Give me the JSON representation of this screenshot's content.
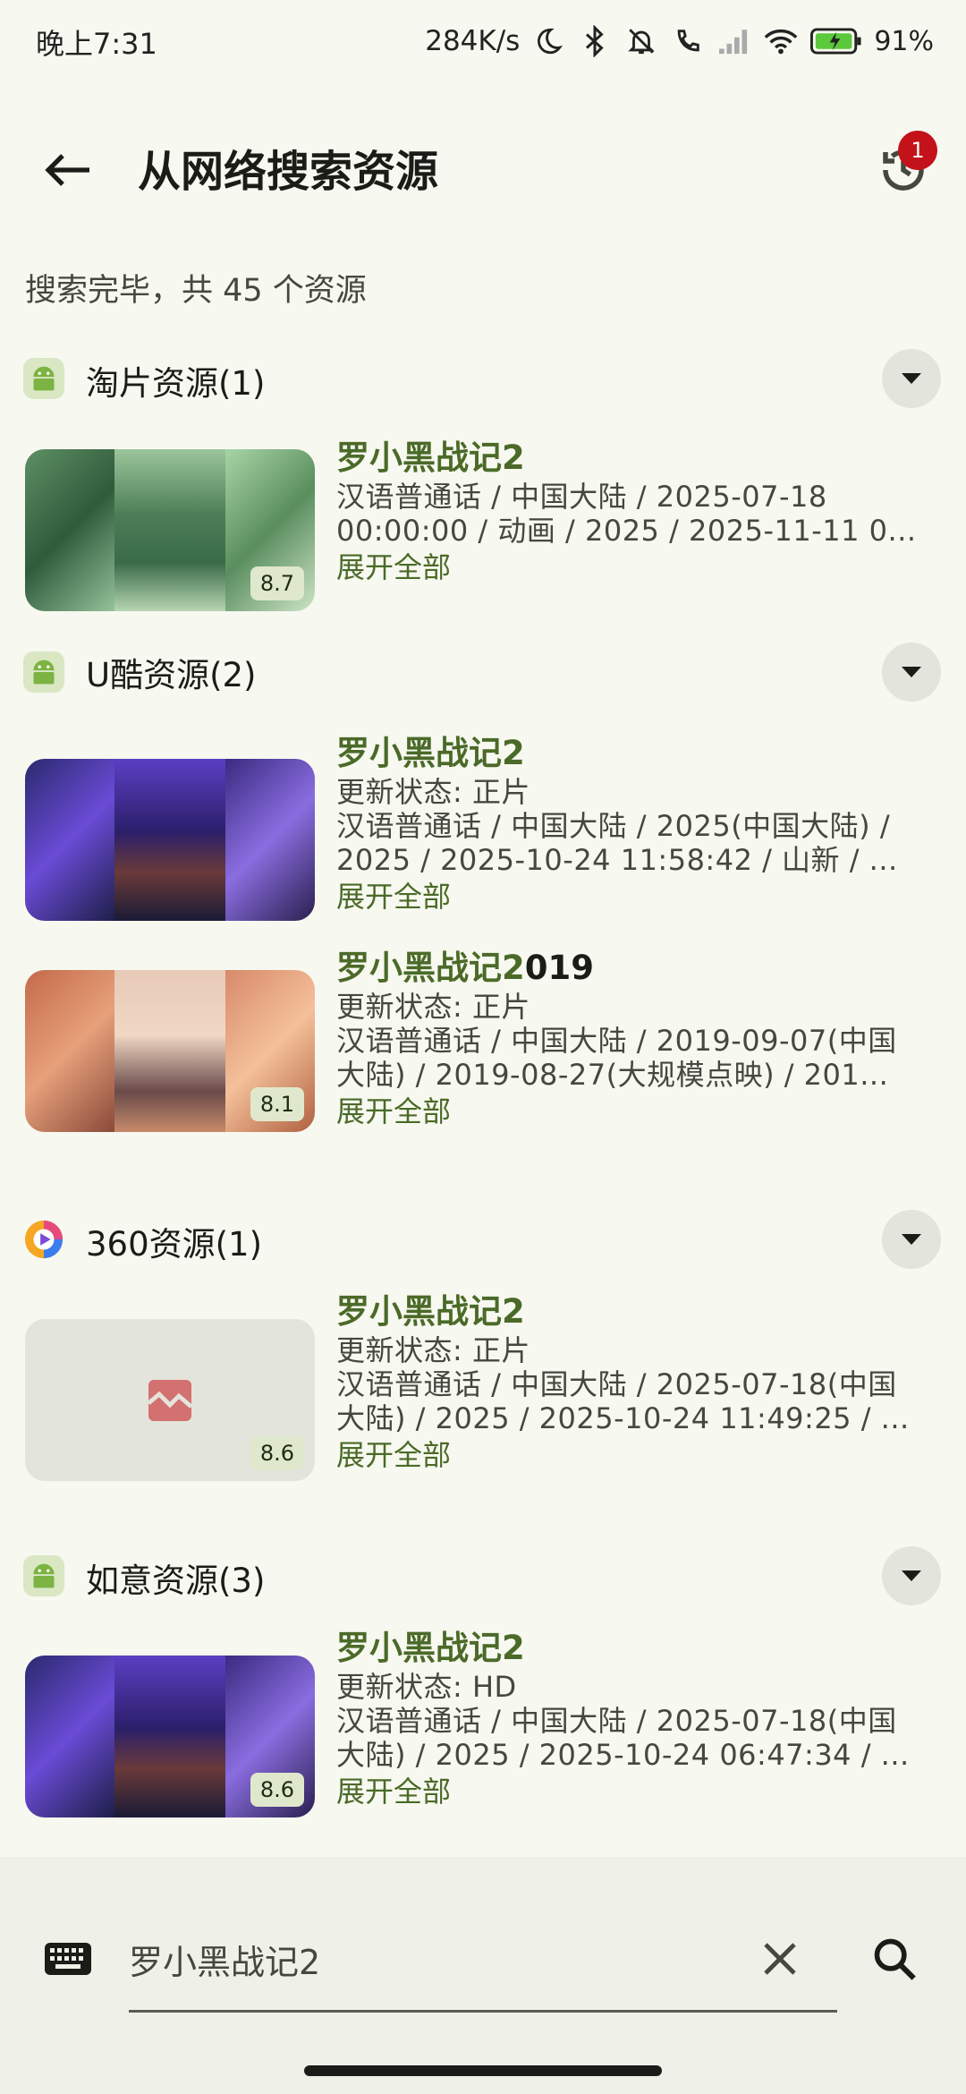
{
  "status_bar": {
    "time": "晚上7:31",
    "speed": "284K/s",
    "battery_pct": "91%"
  },
  "app_bar": {
    "title": "从网络搜索资源",
    "history_badge": "1"
  },
  "summary": "搜索完毕，共 45 个资源",
  "groups": [
    {
      "title": "淘片资源(1)",
      "icon": "android-icon",
      "items": [
        {
          "title": "罗小黑战记2",
          "lines": [
            "汉语普通话 / 中国大陆 / 2025-07-18",
            "00:00:00 / 动画 / 2025 / 2025-11-11 0..."
          ],
          "expand": "展开全部",
          "score": "8.7"
        }
      ]
    },
    {
      "title": "U酷资源(2)",
      "icon": "android-icon",
      "items": [
        {
          "title": "罗小黑战记2",
          "lines": [
            "更新状态: 正片",
            "汉语普通话 / 中国大陆 / 2025(中国大陆) /",
            "2025 / 2025-10-24 11:58:42 / 山新 / ..."
          ],
          "expand": "展开全部",
          "score": ""
        },
        {
          "title_green": "罗小黑战记2",
          "title_plain": "019",
          "lines": [
            "更新状态: 正片",
            "汉语普通话 / 中国大陆 / 2019-09-07(中国",
            "大陆) / 2019-08-27(大规模点映) / 201..."
          ],
          "expand": "展开全部",
          "score": "8.1"
        }
      ]
    },
    {
      "title": "360资源(1)",
      "icon": "360-icon",
      "items": [
        {
          "title": "罗小黑战记2",
          "lines": [
            "更新状态: 正片",
            "汉语普通话 / 中国大陆 / 2025-07-18(中国",
            "大陆) / 2025 / 2025-10-24 11:49:25 / ..."
          ],
          "expand": "展开全部",
          "score": "8.6"
        }
      ]
    },
    {
      "title": "如意资源(3)",
      "icon": "android-icon",
      "items": [
        {
          "title": "罗小黑战记2",
          "lines": [
            "更新状态: HD",
            "汉语普通话 / 中国大陆 / 2025-07-18(中国",
            "大陆) / 2025 / 2025-10-24 06:47:34 / ..."
          ],
          "expand": "展开全部",
          "score": "8.6"
        }
      ]
    }
  ],
  "search": {
    "value": "罗小黑战记2"
  },
  "colors": {
    "background": "#f7f8f0",
    "accent_green": "#4b6a28",
    "badge_red": "#c4121a",
    "score_bg": "#dfe8cc"
  }
}
